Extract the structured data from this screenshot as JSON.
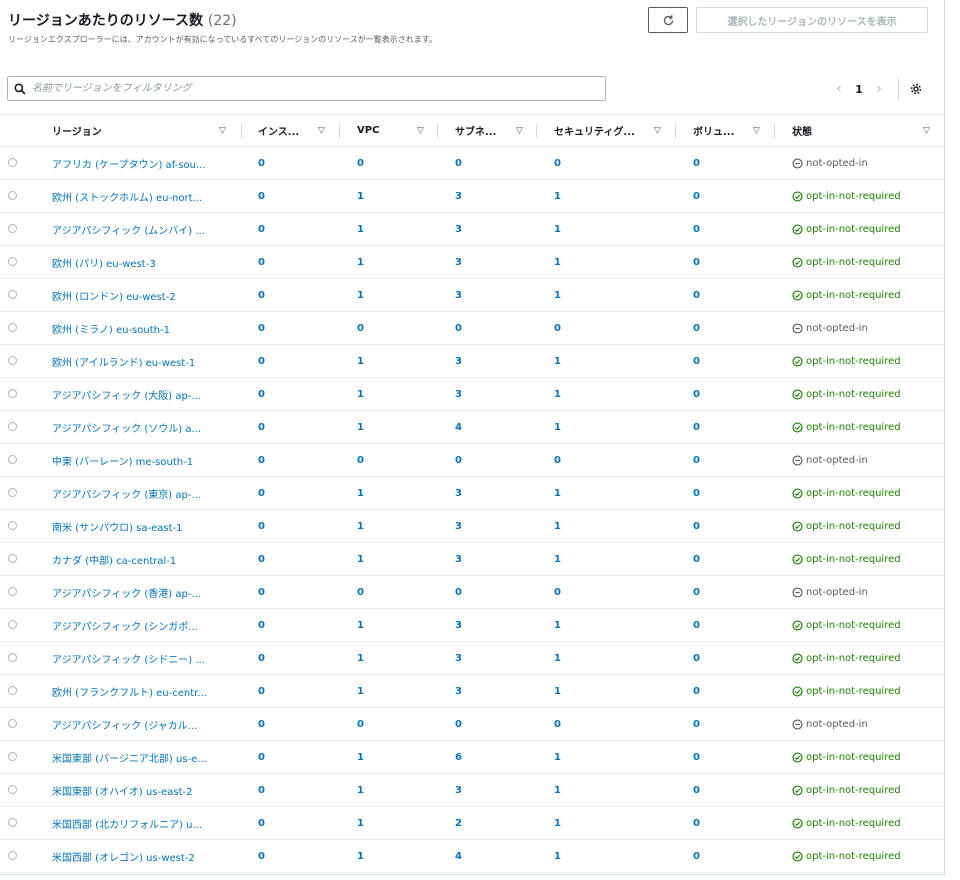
{
  "header": {
    "title": "リージョンあたりのリソース数",
    "count": "(22)",
    "description": "リージョンエクスプローラーには、アカウントが有効になっているすべてのリージョンのリソースが一覧表示されます。",
    "show_button": "選択したリージョンのリソースを表示",
    "refresh_icon": "refresh-icon"
  },
  "filter": {
    "placeholder": "名前でリージョンをフィルタリング",
    "value": "",
    "icon": "search-icon"
  },
  "pagination": {
    "prev_icon": "chevron-left-icon",
    "page": "1",
    "next_icon": "chevron-right-icon",
    "settings_icon": "gear-icon"
  },
  "columns": [
    "リージョン",
    "インス...",
    "VPC",
    "サブネ...",
    "セキュリティグ...",
    "ボリュ...",
    "状態"
  ],
  "status_colors": {
    "ok": "#1d8102",
    "na": "#545b64",
    "link": "#0073bb"
  },
  "rows": [
    {
      "region": "アフリカ (ケープタウン) af-sou...",
      "instances": "0",
      "vpc": "0",
      "subnets": "0",
      "security_groups": "0",
      "volumes": "0",
      "status": "not-opted-in",
      "status_type": "na"
    },
    {
      "region": "欧州 (ストックホルム) eu-nort...",
      "instances": "0",
      "vpc": "1",
      "subnets": "3",
      "security_groups": "1",
      "volumes": "0",
      "status": "opt-in-not-required",
      "status_type": "ok"
    },
    {
      "region": "アジアパシフィック (ムンバイ) ...",
      "instances": "0",
      "vpc": "1",
      "subnets": "3",
      "security_groups": "1",
      "volumes": "0",
      "status": "opt-in-not-required",
      "status_type": "ok"
    },
    {
      "region": "欧州 (パリ) eu-west-3",
      "instances": "0",
      "vpc": "1",
      "subnets": "3",
      "security_groups": "1",
      "volumes": "0",
      "status": "opt-in-not-required",
      "status_type": "ok"
    },
    {
      "region": "欧州 (ロンドン) eu-west-2",
      "instances": "0",
      "vpc": "1",
      "subnets": "3",
      "security_groups": "1",
      "volumes": "0",
      "status": "opt-in-not-required",
      "status_type": "ok"
    },
    {
      "region": "欧州 (ミラノ) eu-south-1",
      "instances": "0",
      "vpc": "0",
      "subnets": "0",
      "security_groups": "0",
      "volumes": "0",
      "status": "not-opted-in",
      "status_type": "na"
    },
    {
      "region": "欧州 (アイルランド) eu-west-1",
      "instances": "0",
      "vpc": "1",
      "subnets": "3",
      "security_groups": "1",
      "volumes": "0",
      "status": "opt-in-not-required",
      "status_type": "ok"
    },
    {
      "region": "アジアパシフィック (大阪) ap-...",
      "instances": "0",
      "vpc": "1",
      "subnets": "3",
      "security_groups": "1",
      "volumes": "0",
      "status": "opt-in-not-required",
      "status_type": "ok"
    },
    {
      "region": "アジアパシフィック (ソウル) a...",
      "instances": "0",
      "vpc": "1",
      "subnets": "4",
      "security_groups": "1",
      "volumes": "0",
      "status": "opt-in-not-required",
      "status_type": "ok"
    },
    {
      "region": "中東 (バーレーン) me-south-1",
      "instances": "0",
      "vpc": "0",
      "subnets": "0",
      "security_groups": "0",
      "volumes": "0",
      "status": "not-opted-in",
      "status_type": "na"
    },
    {
      "region": "アジアパシフィック (東京) ap-...",
      "instances": "0",
      "vpc": "1",
      "subnets": "3",
      "security_groups": "1",
      "volumes": "0",
      "status": "opt-in-not-required",
      "status_type": "ok"
    },
    {
      "region": "南米 (サンパウロ) sa-east-1",
      "instances": "0",
      "vpc": "1",
      "subnets": "3",
      "security_groups": "1",
      "volumes": "0",
      "status": "opt-in-not-required",
      "status_type": "ok"
    },
    {
      "region": "カナダ (中部) ca-central-1",
      "instances": "0",
      "vpc": "1",
      "subnets": "3",
      "security_groups": "1",
      "volumes": "0",
      "status": "opt-in-not-required",
      "status_type": "ok"
    },
    {
      "region": "アジアパシフィック (香港) ap-...",
      "instances": "0",
      "vpc": "0",
      "subnets": "0",
      "security_groups": "0",
      "volumes": "0",
      "status": "not-opted-in",
      "status_type": "na"
    },
    {
      "region": "アジアパシフィック (シンガポ...",
      "instances": "0",
      "vpc": "1",
      "subnets": "3",
      "security_groups": "1",
      "volumes": "0",
      "status": "opt-in-not-required",
      "status_type": "ok"
    },
    {
      "region": "アジアパシフィック (シドニー) ...",
      "instances": "0",
      "vpc": "1",
      "subnets": "3",
      "security_groups": "1",
      "volumes": "0",
      "status": "opt-in-not-required",
      "status_type": "ok"
    },
    {
      "region": "欧州 (フランクフルト) eu-centr...",
      "instances": "0",
      "vpc": "1",
      "subnets": "3",
      "security_groups": "1",
      "volumes": "0",
      "status": "opt-in-not-required",
      "status_type": "ok"
    },
    {
      "region": "アジアパシフィック (ジャカル...",
      "instances": "0",
      "vpc": "0",
      "subnets": "0",
      "security_groups": "0",
      "volumes": "0",
      "status": "not-opted-in",
      "status_type": "na"
    },
    {
      "region": "米国東部 (バージニア北部) us-e...",
      "instances": "0",
      "vpc": "1",
      "subnets": "6",
      "security_groups": "1",
      "volumes": "0",
      "status": "opt-in-not-required",
      "status_type": "ok"
    },
    {
      "region": "米国東部 (オハイオ) us-east-2",
      "instances": "0",
      "vpc": "1",
      "subnets": "3",
      "security_groups": "1",
      "volumes": "0",
      "status": "opt-in-not-required",
      "status_type": "ok"
    },
    {
      "region": "米国西部 (北カリフォルニア) u...",
      "instances": "0",
      "vpc": "1",
      "subnets": "2",
      "security_groups": "1",
      "volumes": "0",
      "status": "opt-in-not-required",
      "status_type": "ok"
    },
    {
      "region": "米国西部 (オレゴン) us-west-2",
      "instances": "0",
      "vpc": "1",
      "subnets": "4",
      "security_groups": "1",
      "volumes": "0",
      "status": "opt-in-not-required",
      "status_type": "ok"
    }
  ]
}
